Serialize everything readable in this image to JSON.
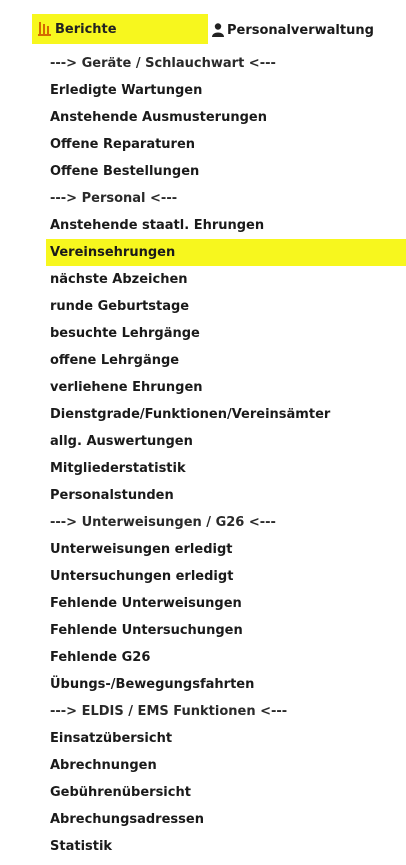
{
  "tabs": {
    "reports_label": "Berichte",
    "personnel_label": "Personalverwaltung",
    "reports_icon": "bar-chart-icon",
    "personnel_icon": "person-icon",
    "highlight_color": "#f7f71e"
  },
  "menu": {
    "items": [
      {
        "label": "---> Geräte / Schlauchwart <---",
        "type": "section"
      },
      {
        "label": "Erledigte Wartungen",
        "type": "link"
      },
      {
        "label": "Anstehende Ausmusterungen",
        "type": "link"
      },
      {
        "label": "Offene Reparaturen",
        "type": "link"
      },
      {
        "label": "Offene Bestellungen",
        "type": "link"
      },
      {
        "label": "---> Personal <---",
        "type": "section"
      },
      {
        "label": "Anstehende staatl. Ehrungen",
        "type": "link"
      },
      {
        "label": "Vereinsehrungen",
        "type": "link",
        "highlighted": true
      },
      {
        "label": "nächste Abzeichen",
        "type": "link"
      },
      {
        "label": "runde Geburtstage",
        "type": "link"
      },
      {
        "label": "besuchte Lehrgänge",
        "type": "link"
      },
      {
        "label": "offene Lehrgänge",
        "type": "link"
      },
      {
        "label": "verliehene Ehrungen",
        "type": "link"
      },
      {
        "label": "Dienstgrade/Funktionen/Vereinsämter",
        "type": "link"
      },
      {
        "label": "allg. Auswertungen",
        "type": "link"
      },
      {
        "label": "Mitgliederstatistik",
        "type": "link"
      },
      {
        "label": "Personalstunden",
        "type": "link"
      },
      {
        "label": "---> Unterweisungen / G26 <---",
        "type": "section"
      },
      {
        "label": "Unterweisungen erledigt",
        "type": "link"
      },
      {
        "label": "Untersuchungen erledigt",
        "type": "link"
      },
      {
        "label": "Fehlende Unterweisungen",
        "type": "link"
      },
      {
        "label": "Fehlende Untersuchungen",
        "type": "link"
      },
      {
        "label": "Fehlende G26",
        "type": "link"
      },
      {
        "label": "Übungs-/Bewegungsfahrten",
        "type": "link"
      },
      {
        "label": "---> ELDIS / EMS Funktionen <---",
        "type": "section"
      },
      {
        "label": "Einsatzübersicht",
        "type": "link"
      },
      {
        "label": "Abrechnungen",
        "type": "link"
      },
      {
        "label": "Gebührenübersicht",
        "type": "link"
      },
      {
        "label": "Abrechungsadressen",
        "type": "link"
      },
      {
        "label": "Statistik",
        "type": "link"
      }
    ]
  }
}
